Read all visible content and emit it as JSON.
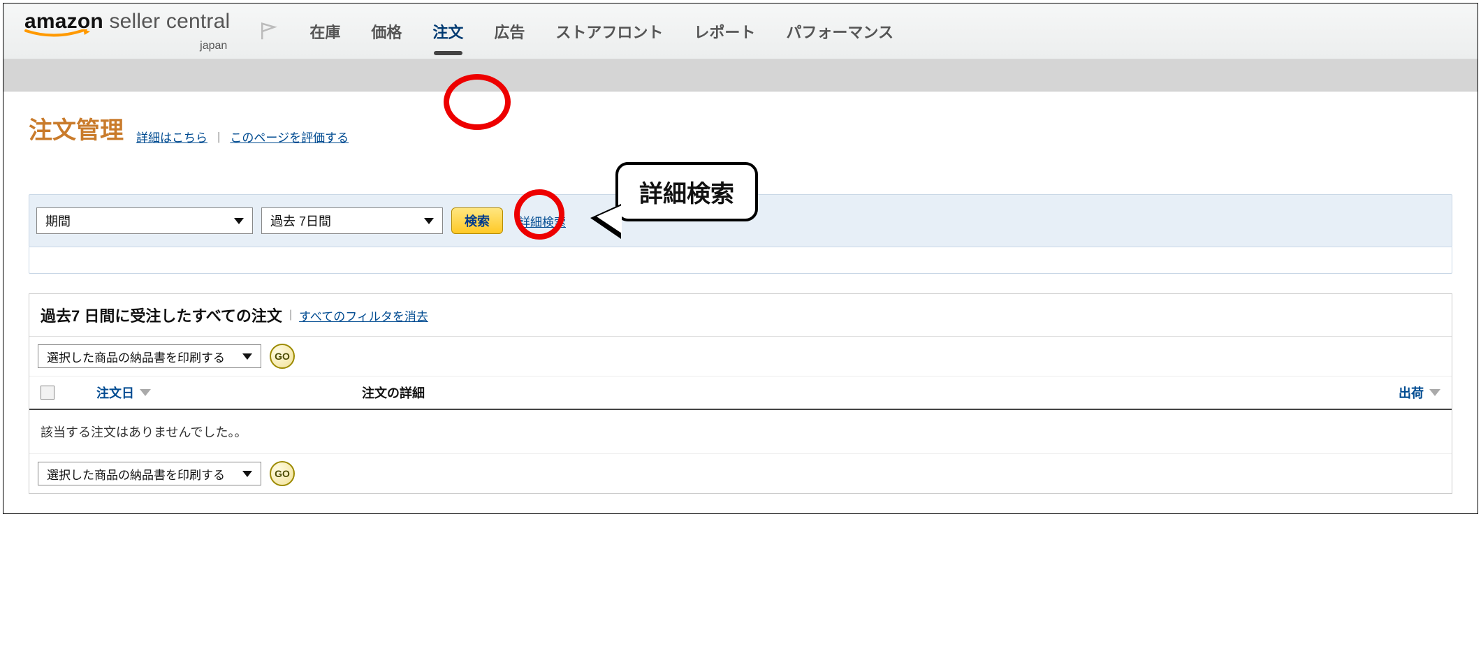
{
  "header": {
    "logo_main": "amazon",
    "logo_sc": "seller central",
    "logo_sub": "japan",
    "nav": [
      "在庫",
      "価格",
      "注文",
      "広告",
      "ストアフロント",
      "レポート",
      "パフォーマンス"
    ],
    "active_nav_index": 2
  },
  "title": {
    "page_title": "注文管理",
    "details_link": "詳細はこちら",
    "rate_link": "このページを評価する"
  },
  "search": {
    "field_select": "期間",
    "range_select": "過去 7日間",
    "search_btn": "検索",
    "advanced_link": "詳細検索"
  },
  "callout": {
    "label": "詳細検索"
  },
  "results": {
    "heading": "過去7 日間に受注したすべての注文",
    "clear_filters": "すべてのフィルタを消去",
    "action_select": "選択した商品の納品書を印刷する",
    "go_btn": "GO",
    "col_order_date": "注文日",
    "col_order_detail": "注文の詳細",
    "col_ship": "出荷",
    "empty": "該当する注文はありませんでした。。"
  }
}
